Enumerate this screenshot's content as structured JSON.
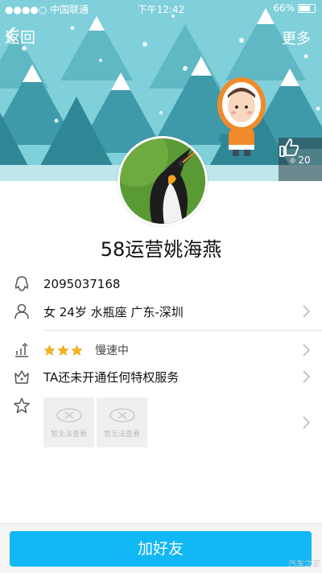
{
  "status_bar": {
    "carrier": "●●●●○ 中国联通",
    "time": "下午12:42",
    "battery": "66%"
  },
  "nav": {
    "back_label": "返回",
    "more_label": "更多"
  },
  "like": {
    "count": "20"
  },
  "profile": {
    "name": "58运营姚海燕",
    "qq": "2095037168",
    "details": "女 24岁 水瓶座 广东-深圳",
    "level_status": "慢速中",
    "level_stars": 3,
    "privilege": "TA还未开通任何特权服务",
    "gifts": [
      {
        "caption": "暂无法查看"
      },
      {
        "caption": "暂无法查看"
      }
    ]
  },
  "actions": {
    "add_friend": "加好友"
  },
  "watermark": "汽车之家",
  "colors": {
    "accent": "#12b7f5",
    "banner": "#79cfd9",
    "star": "#f5b51a"
  }
}
